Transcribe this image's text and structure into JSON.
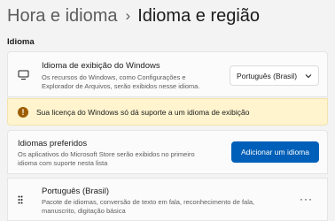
{
  "breadcrumb": {
    "parent": "Hora e idioma",
    "separator": "›",
    "current": "Idioma e região"
  },
  "section": {
    "title": "Idioma"
  },
  "display_language": {
    "title": "Idioma de exibição do Windows",
    "description_line1": "Os recursos do Windows, como Configurações e",
    "description_line2": "Explorador de Arquivos, serão exibidos nesse idioma.",
    "selected": "Português (Brasil)",
    "icon": "monitor-icon"
  },
  "warning": {
    "icon": "info-icon",
    "text": "Sua licença do Windows só dá suporte a um idioma de exibição"
  },
  "preferred_languages": {
    "title": "Idiomas preferidos",
    "description_line1": "Os aplicativos do Microsoft Store serão exibidos no primeiro",
    "description_line2": "idioma com suporte nesta lista",
    "add_button": "Adicionar um idioma"
  },
  "language_item": {
    "name": "Português (Brasil)",
    "features_line1": "Pacote de idiomas, conversão de texto em fala, reconhecimento de fala,",
    "features_line2": "manuscrito, digitação básica",
    "more": "···"
  },
  "colors": {
    "accent": "#005fb8",
    "warning_bg": "#fff4ce",
    "warning_icon": "#9d5d00"
  }
}
